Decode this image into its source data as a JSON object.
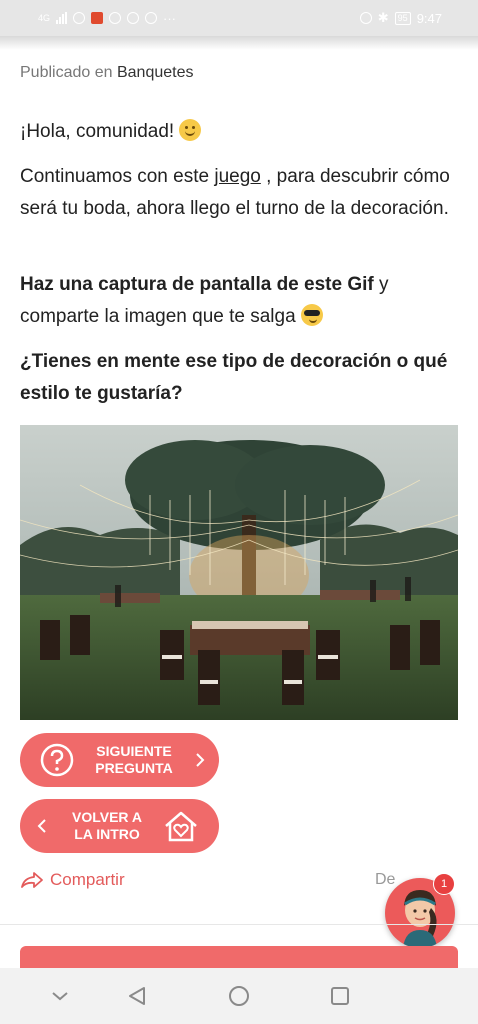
{
  "status_bar": {
    "network": "4G",
    "battery": "95",
    "time": "9:47",
    "accent_icon_color": "#e04a2e"
  },
  "post": {
    "published_prefix": "Publicado en",
    "category": "Banquetes",
    "greeting": "¡Hola, comunidad!",
    "greeting_emoji": "smiling-face-emoji",
    "para1_before": "Continuamos con este",
    "para1_link": "juego",
    "para1_after": ", para descubrir cómo será tu boda, ahora llego el turno de la decoración.",
    "para2_bold1": "Haz una captura de pantalla de este",
    "para2_bold2": "Gif",
    "para2_rest": "y comparte la imagen que te salga",
    "para2_emoji": "cool-sunglasses-emoji",
    "question": "¿Tienes en mente ese tipo de decoración o qué estilo te gustaría?"
  },
  "image": {
    "description_icon": "outdoor-wedding-banquet-photo"
  },
  "buttons": {
    "next": "SIGUIENTE PREGUNTA",
    "back": "VOLVER A LA INTRO"
  },
  "actions": {
    "share": "Compartir",
    "report": "De"
  },
  "assistant": {
    "badge_count": "1"
  },
  "colors": {
    "brand": "#f06a6a",
    "link": "#e35b5b"
  }
}
